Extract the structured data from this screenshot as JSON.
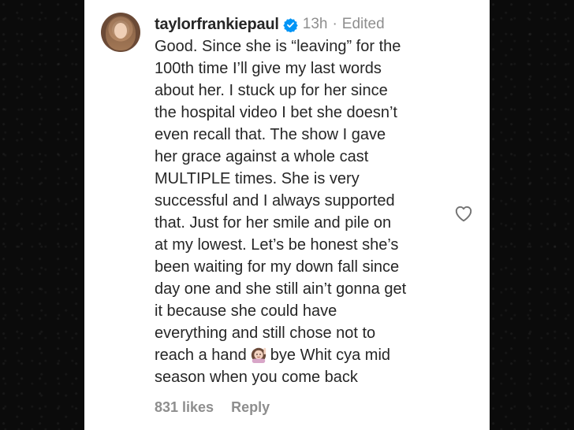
{
  "comment": {
    "username": "taylorfrankiepaul",
    "time": "13h",
    "separator": "·",
    "edited": "Edited",
    "text_before_emoji": "Good. Since she is “leaving” for the\n100th time I’ll give my last words\nabout her. I stuck up for her since\nthe hospital video I bet she doesn’t\neven recall that. The show I gave\nher grace against a whole cast\nMULTIPLE times. She is very\nsuccessful and I always supported\nthat. Just for her smile and pile on\nat my lowest. Let’s be honest she’s\nbeen waiting for my down fall since\nday one and she still ain’t gonna get\nit because she could have\neverything and still chose not to\nreach a hand",
    "text_after_emoji": "bye Whit cya mid\nseason when you come back",
    "emoji_name": "woman-raising-hand-emoji",
    "likes": "831 likes",
    "reply_label": "Reply"
  },
  "icons": {
    "verified": "verified-badge-icon",
    "like": "heart-icon"
  },
  "colors": {
    "verified_blue": "#0095f6",
    "text": "#262626",
    "muted": "#8e8e8e"
  }
}
